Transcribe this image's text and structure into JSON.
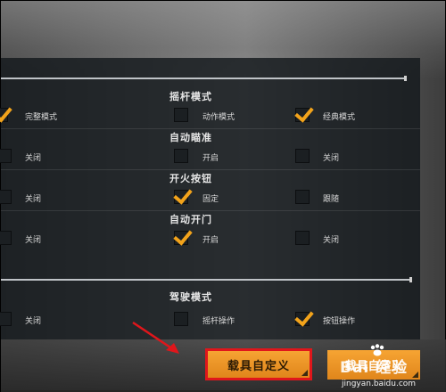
{
  "sections": [
    {
      "title": "摇杆模式",
      "options": [
        {
          "label": "完整模式",
          "checked": true
        },
        {
          "label": "动作模式",
          "checked": false
        },
        {
          "label": "经典模式",
          "checked": true
        }
      ]
    },
    {
      "title": "自动瞄准",
      "options": [
        {
          "label": "关闭",
          "checked": false
        },
        {
          "label": "开启",
          "checked": false
        },
        {
          "label": "关闭",
          "checked": false
        }
      ]
    },
    {
      "title": "开火按钮",
      "options": [
        {
          "label": "关闭",
          "checked": false
        },
        {
          "label": "固定",
          "checked": true
        },
        {
          "label": "跟随",
          "checked": false
        }
      ]
    },
    {
      "title": "自动开门",
      "options": [
        {
          "label": "关闭",
          "checked": false
        },
        {
          "label": "开启",
          "checked": true
        },
        {
          "label": "关闭",
          "checked": false
        }
      ]
    },
    {
      "title": "驾驶模式",
      "options": [
        {
          "label": "关闭",
          "checked": false
        },
        {
          "label": "摇杆操作",
          "checked": false
        },
        {
          "label": "按钮操作",
          "checked": true
        }
      ]
    }
  ],
  "buttons": {
    "vehicle_custom": "载具自定义",
    "other": "载具自定义"
  },
  "watermark": {
    "brand": "Bai 经验",
    "sub": "jingyan.baidu.com"
  },
  "colors": {
    "accent": "#f2a31b",
    "highlight_border": "#e0161b"
  }
}
